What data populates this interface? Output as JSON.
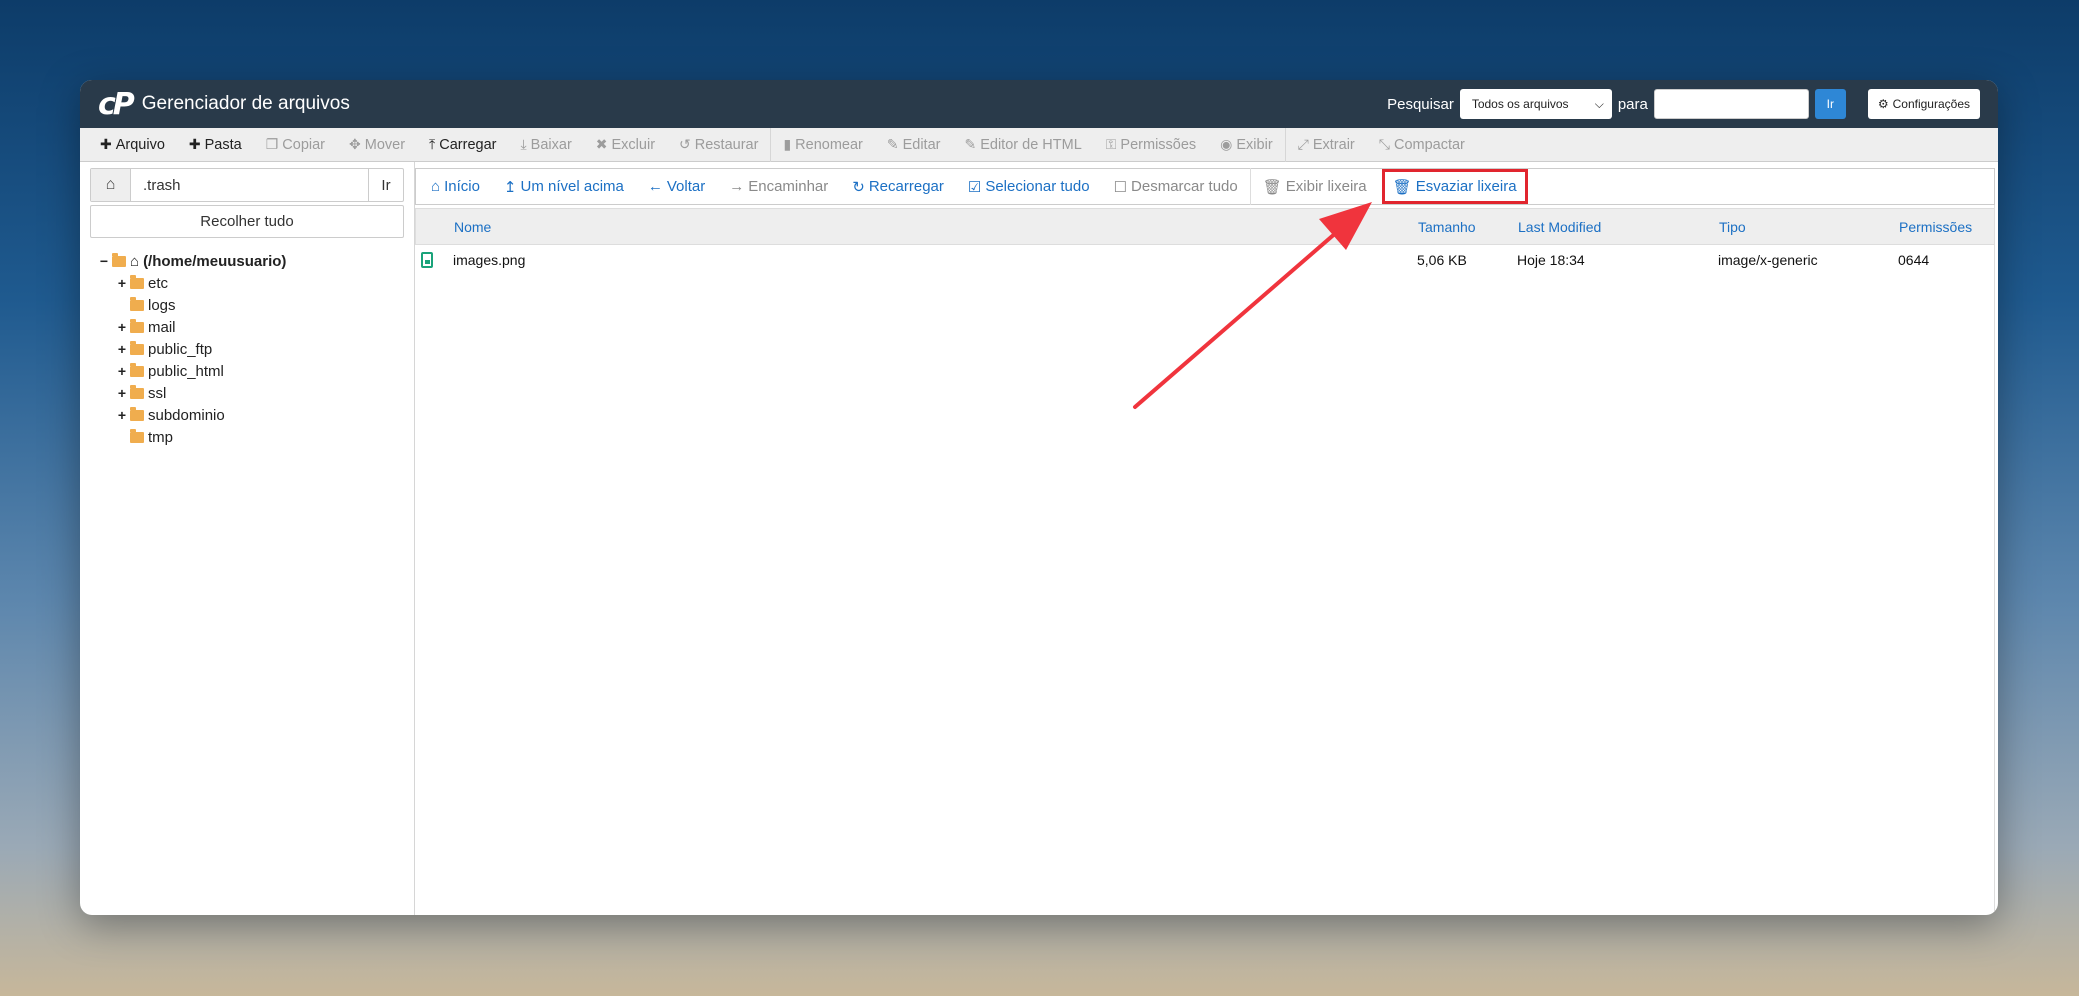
{
  "app": {
    "title": "Gerenciador de arquivos",
    "logo_text": "cP"
  },
  "search": {
    "label": "Pesquisar",
    "scope_selected": "Todos os arquivos",
    "for_label": "para",
    "input_value": "",
    "go_label": "Ir",
    "settings_label": "Configurações"
  },
  "toolbar": {
    "items": [
      {
        "label": "Arquivo",
        "icon": "plus-icon"
      },
      {
        "label": "Pasta",
        "icon": "plus-icon"
      },
      {
        "label": "Copiar",
        "icon": "copy-icon"
      },
      {
        "label": "Mover",
        "icon": "move-icon"
      },
      {
        "label": "Carregar",
        "icon": "upload-icon"
      },
      {
        "label": "Baixar",
        "icon": "download-icon"
      },
      {
        "label": "Excluir",
        "icon": "x-icon"
      },
      {
        "label": "Restaurar",
        "icon": "undo-icon"
      },
      {
        "label": "Renomear",
        "icon": "file-icon"
      },
      {
        "label": "Editar",
        "icon": "pencil-icon"
      },
      {
        "label": "Editor de HTML",
        "icon": "edit-icon"
      },
      {
        "label": "Permissões",
        "icon": "key-icon"
      },
      {
        "label": "Exibir",
        "icon": "eye-icon"
      },
      {
        "label": "Extrair",
        "icon": "expand-icon"
      },
      {
        "label": "Compactar",
        "icon": "compress-icon"
      }
    ]
  },
  "sidebar": {
    "path_value": ".trash",
    "path_go_label": "Ir",
    "collapse_label": "Recolher tudo",
    "tree": {
      "root": "(/home/meuusuario)",
      "items": [
        {
          "label": "etc"
        },
        {
          "label": "logs"
        },
        {
          "label": "mail"
        },
        {
          "label": "public_ftp"
        },
        {
          "label": "public_html"
        },
        {
          "label": "ssl"
        },
        {
          "label": "subdominio"
        },
        {
          "label": "tmp"
        }
      ]
    }
  },
  "navbar": {
    "items": [
      {
        "label": "Início",
        "icon": "home-icon"
      },
      {
        "label": "Um nível acima",
        "icon": "level-up-icon"
      },
      {
        "label": "Voltar",
        "icon": "arrow-left-icon"
      },
      {
        "label": "Encaminhar",
        "icon": "arrow-right-icon"
      },
      {
        "label": "Recarregar",
        "icon": "refresh-icon"
      },
      {
        "label": "Selecionar tudo",
        "icon": "checkbox-checked-icon"
      },
      {
        "label": "Desmarcar tudo",
        "icon": "checkbox-empty-icon"
      },
      {
        "label": "Exibir lixeira",
        "icon": "trash-icon"
      },
      {
        "label": "Esvaziar lixeira",
        "icon": "trash-icon"
      }
    ]
  },
  "table": {
    "columns": [
      "Nome",
      "Tamanho",
      "Last Modified",
      "Tipo",
      "Permissões"
    ],
    "rows": [
      {
        "name": "images.png",
        "size": "5,06 KB",
        "modified": "Hoje 18:34",
        "type": "image/x-generic",
        "perms": "0644"
      }
    ]
  },
  "colors": {
    "titlebar": "#293a4a",
    "accent": "#1c70c4",
    "highlight": "#e1252e"
  }
}
